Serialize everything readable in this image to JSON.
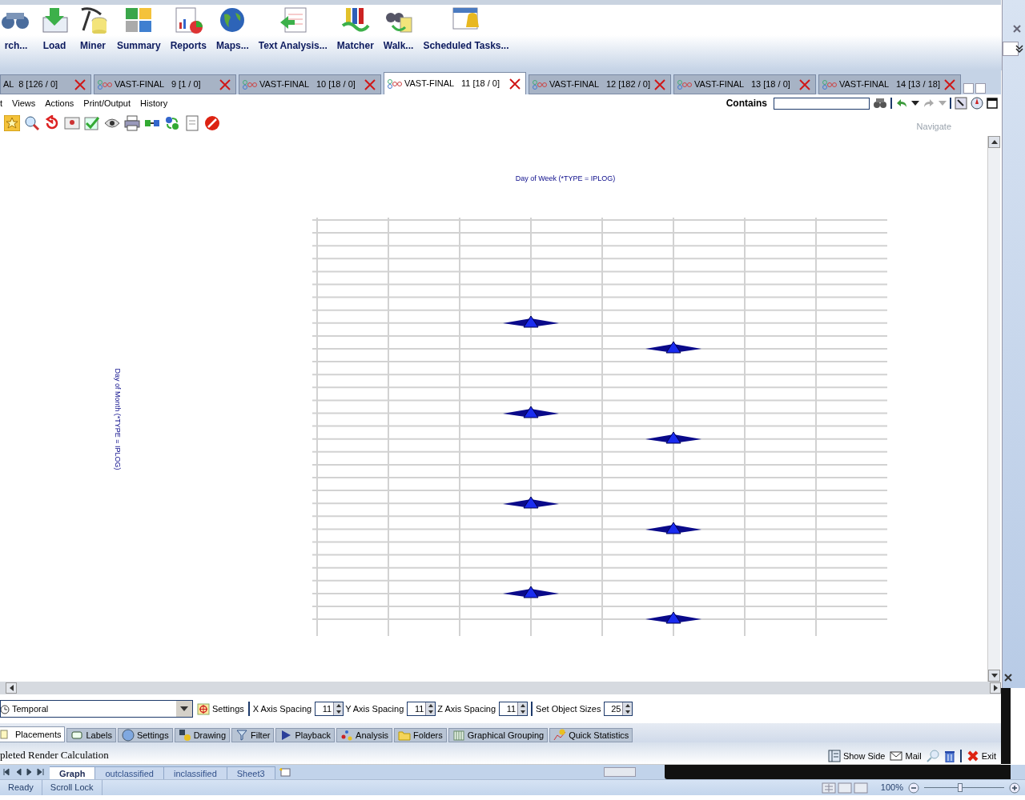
{
  "ribbon": [
    {
      "label": "rch..."
    },
    {
      "label": "Load"
    },
    {
      "label": "Miner"
    },
    {
      "label": "Summary"
    },
    {
      "label": "Reports"
    },
    {
      "label": "Maps..."
    },
    {
      "label": "Text Analysis..."
    },
    {
      "label": "Matcher"
    },
    {
      "label": "Walk..."
    },
    {
      "label": "Scheduled Tasks..."
    }
  ],
  "document_tabs": [
    {
      "label": "AL  8 [126 / 0]",
      "selected": false
    },
    {
      "label": "VAST-FINAL   9 [1 / 0]",
      "selected": false
    },
    {
      "label": "VAST-FINAL   10 [18 / 0]",
      "selected": false
    },
    {
      "label": "VAST-FINAL   11 [18 / 0]",
      "selected": true
    },
    {
      "label": "VAST-FINAL   12 [182 / 0]",
      "selected": false
    },
    {
      "label": "VAST-FINAL   13 [18 / 0]",
      "selected": false
    },
    {
      "label": "VAST-FINAL   14 [13 / 18]",
      "selected": false
    }
  ],
  "menu": [
    "t",
    "Views",
    "Actions",
    "Print/Output",
    "History"
  ],
  "search": {
    "label": "Contains"
  },
  "navigate_label": "Navigate",
  "graph": {
    "title": "Day of Week (*TYPE = IPLOG)",
    "y_axis_title": "Day of Month (*TYPE = IPLOG)"
  },
  "controls": {
    "layout": "Temporal",
    "settings": "Settings",
    "spinners": [
      {
        "label": "X Axis Spacing",
        "value": "11"
      },
      {
        "label": "Y Axis Spacing",
        "value": "11"
      },
      {
        "label": "Z Axis Spacing",
        "value": "11"
      },
      {
        "label": "Set Object Sizes",
        "value": "25"
      }
    ]
  },
  "panel_tabs": [
    {
      "label": "Placements",
      "selected": true
    },
    {
      "label": "Labels",
      "selected": false
    },
    {
      "label": "Settings",
      "selected": false
    },
    {
      "label": "Drawing",
      "selected": false
    },
    {
      "label": "Filter",
      "selected": false
    },
    {
      "label": "Playback",
      "selected": false
    },
    {
      "label": "Analysis",
      "selected": false
    },
    {
      "label": "Folders",
      "selected": false
    },
    {
      "label": "Graphical Grouping",
      "selected": false
    },
    {
      "label": "Quick Statistics",
      "selected": false
    }
  ],
  "status": {
    "message": "pleted Render Calculation",
    "actions": [
      "Show Side",
      "Mail",
      "Exit"
    ]
  },
  "sheet_tabs": [
    {
      "label": "Graph",
      "selected": true
    },
    {
      "label": "outclassified",
      "selected": false
    },
    {
      "label": "inclassified",
      "selected": false
    },
    {
      "label": "Sheet3",
      "selected": false
    }
  ],
  "excel_status": {
    "items": [
      "Ready",
      "Scroll Lock"
    ],
    "zoom": "100%"
  },
  "zoom_slider": {
    "level": 0.45
  }
}
